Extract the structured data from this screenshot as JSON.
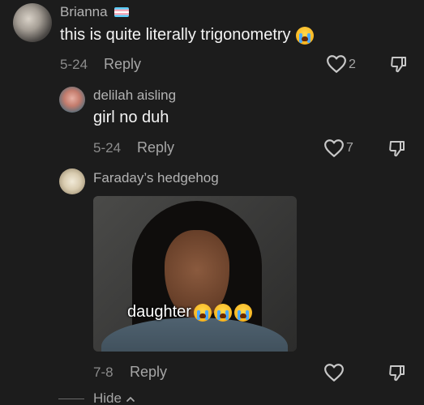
{
  "comments": [
    {
      "username": "Brianna",
      "text": "this is quite literally trigonometry",
      "date": "5-24",
      "reply_label": "Reply",
      "likes": "2"
    },
    {
      "username": "delilah aisling",
      "text": "girl no duh",
      "date": "5-24",
      "reply_label": "Reply",
      "likes": "7"
    },
    {
      "username": "Faraday’s hedgehog",
      "image_caption": "daughter",
      "date": "7-8",
      "reply_label": "Reply",
      "likes": ""
    }
  ],
  "thread": {
    "hide_label": "Hide"
  },
  "icons": {
    "like": "heart-icon",
    "dislike": "thumbs-down-icon",
    "flag": "trans-flag-icon",
    "emoji": "loudly-crying-face-emoji"
  },
  "colors": {
    "background": "#1c1c1c",
    "text_primary": "#f4f4f4",
    "text_secondary": "#a6a6a6"
  }
}
